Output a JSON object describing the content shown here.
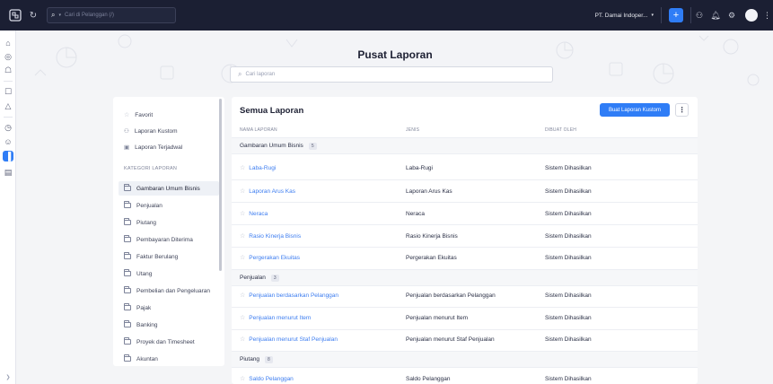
{
  "topbar": {
    "search_placeholder": "Cari di Pelanggan (/)",
    "org_name": "PT. Damai Indoper...",
    "plus": "+"
  },
  "hero": {
    "title": "Pusat Laporan",
    "search_placeholder": "Cari laporan"
  },
  "sidebar": {
    "favorite": "Favorit",
    "custom": "Laporan Kustom",
    "scheduled": "Laporan Terjadwal",
    "category_heading": "KATEGORI LAPORAN",
    "categories": [
      "Gambaran Umum Bisnis",
      "Penjualan",
      "Piutang",
      "Pembayaran Diterima",
      "Faktur Berulang",
      "Utang",
      "Pembelian dan Pengeluaran",
      "Pajak",
      "Banking",
      "Proyek dan Timesheet",
      "Akuntan"
    ]
  },
  "main": {
    "title": "Semua Laporan",
    "create_button": "Buat Laporan Kustom",
    "more": "⋮",
    "columns": [
      "NAMA LAPORAN",
      "JENIS",
      "DIBUAT OLEH"
    ],
    "groups": [
      {
        "name": "Gambaran Umum Bisnis",
        "count": "5",
        "rows": [
          {
            "name": "Laba-Rugi",
            "type": "Laba-Rugi",
            "by": "Sistem Dihasilkan"
          },
          {
            "name": "Laporan Arus Kas",
            "type": "Laporan Arus Kas",
            "by": "Sistem Dihasilkan"
          },
          {
            "name": "Neraca",
            "type": "Neraca",
            "by": "Sistem Dihasilkan"
          },
          {
            "name": "Rasio Kinerja Bisnis",
            "type": "Rasio Kinerja Bisnis",
            "by": "Sistem Dihasilkan"
          },
          {
            "name": "Pergerakan Ekuitas",
            "type": "Pergerakan Ekuitas",
            "by": "Sistem Dihasilkan"
          }
        ]
      },
      {
        "name": "Penjualan",
        "count": "3",
        "rows": [
          {
            "name": "Penjualan berdasarkan Pelanggan",
            "type": "Penjualan berdasarkan Pelanggan",
            "by": "Sistem Dihasilkan"
          },
          {
            "name": "Penjualan menurut Item",
            "type": "Penjualan menurut Item",
            "by": "Sistem Dihasilkan"
          },
          {
            "name": "Penjualan menurut Staf Penjualan",
            "type": "Penjualan menurut Staf Penjualan",
            "by": "Sistem Dihasilkan"
          }
        ]
      },
      {
        "name": "Piutang",
        "count": "8",
        "rows": [
          {
            "name": "Saldo Pelanggan",
            "type": "Saldo Pelanggan",
            "by": "Sistem Dihasilkan"
          }
        ]
      }
    ]
  },
  "colors": {
    "topbar": "#1b1f33",
    "accent": "#2f7df6",
    "link": "#3d7df0"
  }
}
